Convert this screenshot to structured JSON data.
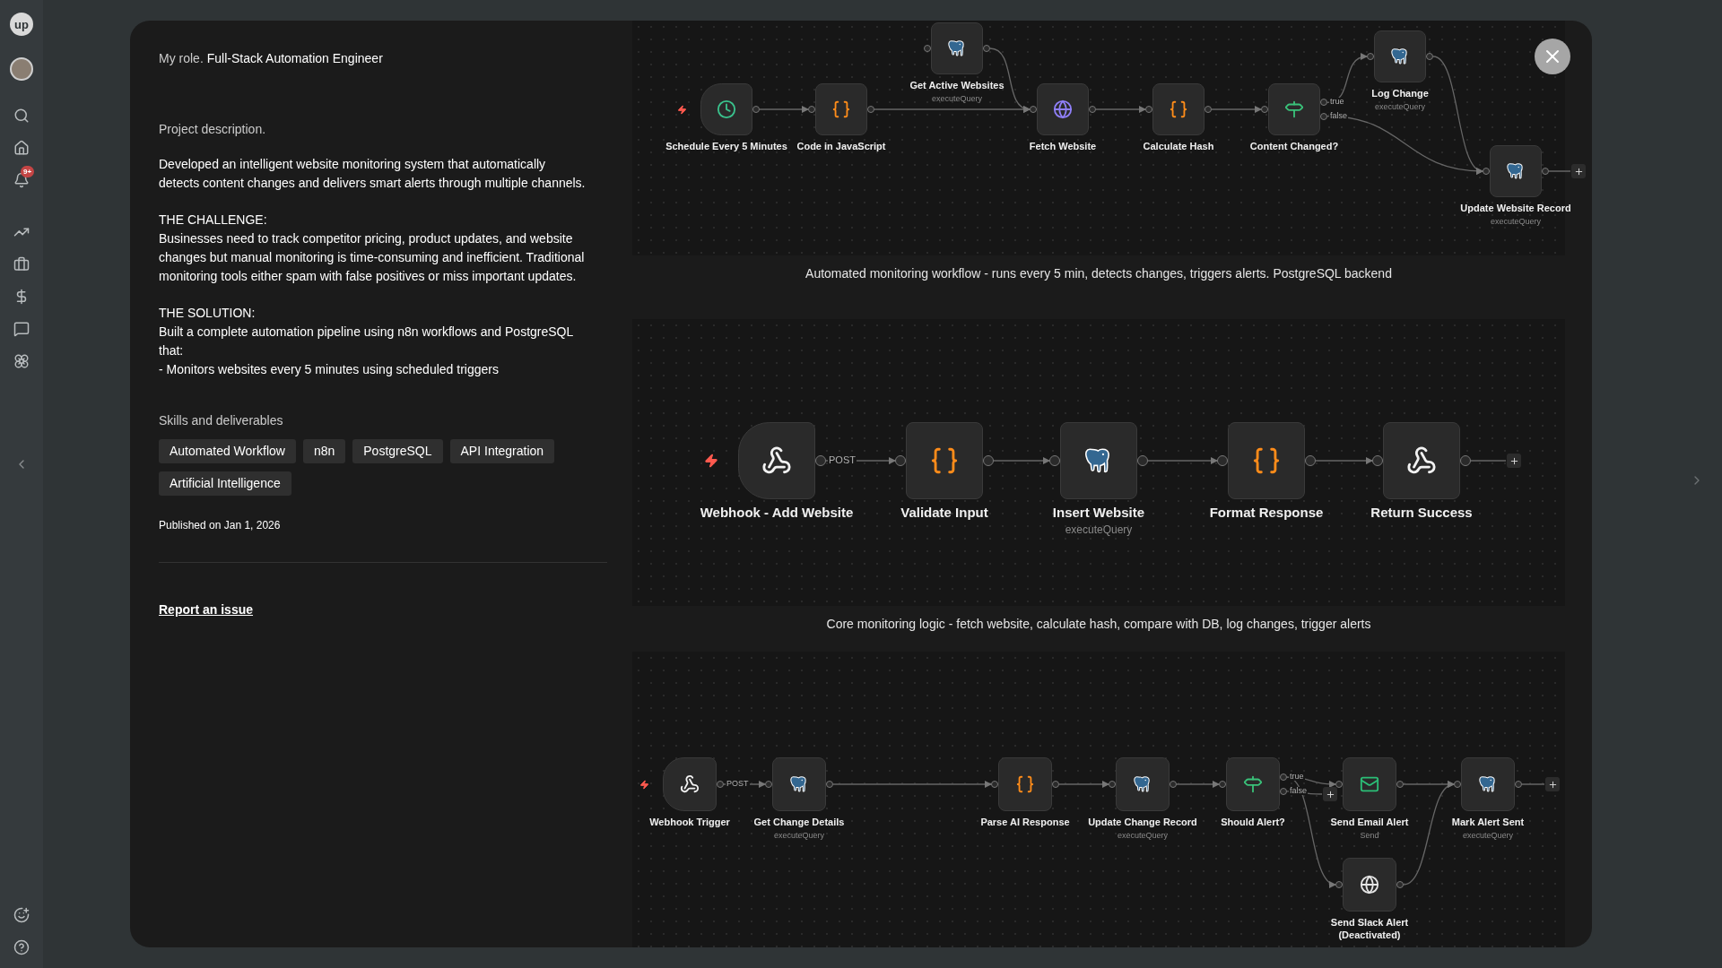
{
  "sidebar": {
    "logo": "up",
    "notification_badge": "9+"
  },
  "modal": {
    "role_label": "My role.",
    "role": "Full-Stack Automation Engineer",
    "description_label": "Project description.",
    "description": [
      "Developed an intelligent website monitoring system that automatically detects content changes and delivers smart alerts through multiple channels.",
      "THE CHALLENGE:\nBusinesses need to track competitor pricing, product updates, and website changes but manual monitoring is time-consuming and inefficient. Traditional monitoring tools either spam with false positives or miss important updates.",
      "THE SOLUTION:\nBuilt a complete automation pipeline using n8n workflows and PostgreSQL that:\n- Monitors websites every 5 minutes using scheduled triggers"
    ],
    "skills_label": "Skills and deliverables",
    "skills": [
      "Automated Workflow",
      "n8n",
      "PostgreSQL",
      "API Integration",
      "Artificial Intelligence"
    ],
    "published": "Published on Jan 1, 2026",
    "report_link": "Report an issue",
    "workflows": [
      {
        "caption": "Automated monitoring workflow - runs every 5 min, detects changes, triggers alerts. PostgreSQL backend",
        "nodes": [
          {
            "kind": "schedule",
            "label": "Schedule Every 5 Minutes"
          },
          {
            "kind": "code",
            "label": "Code in JavaScript"
          },
          {
            "kind": "postgres",
            "label": "Get Active Websites",
            "sub": "executeQuery"
          },
          {
            "kind": "http",
            "label": "Fetch Website"
          },
          {
            "kind": "code",
            "label": "Calculate Hash"
          },
          {
            "kind": "if",
            "label": "Content Changed?",
            "outputs": [
              "true",
              "false"
            ]
          },
          {
            "kind": "postgres",
            "label": "Log Change",
            "sub": "executeQuery"
          },
          {
            "kind": "postgres",
            "label": "Update Website Record",
            "sub": "executeQuery"
          }
        ]
      },
      {
        "caption": "Core monitoring logic - fetch website, calculate hash, compare with DB, log changes, trigger alerts",
        "nodes": [
          {
            "kind": "webhook",
            "label": "Webhook - Add Website",
            "outputs": [
              "POST"
            ]
          },
          {
            "kind": "code",
            "label": "Validate Input"
          },
          {
            "kind": "postgres",
            "label": "Insert Website",
            "sub": "executeQuery"
          },
          {
            "kind": "code",
            "label": "Format Response"
          },
          {
            "kind": "respond",
            "label": "Return Success"
          }
        ]
      },
      {
        "nodes": [
          {
            "kind": "webhook",
            "label": "Webhook Trigger",
            "outputs": [
              "POST"
            ]
          },
          {
            "kind": "postgres",
            "label": "Get Change Details",
            "sub": "executeQuery"
          },
          {
            "kind": "code",
            "label": "Parse AI Response"
          },
          {
            "kind": "postgres",
            "label": "Update Change Record",
            "sub": "executeQuery"
          },
          {
            "kind": "if",
            "label": "Should Alert?",
            "outputs": [
              "true",
              "false"
            ]
          },
          {
            "kind": "email",
            "label": "Send Email Alert",
            "sub": "Send"
          },
          {
            "kind": "postgres",
            "label": "Mark Alert Sent",
            "sub": "executeQuery"
          },
          {
            "kind": "slack",
            "label": "Send Slack Alert (Deactivated)"
          }
        ]
      }
    ]
  }
}
